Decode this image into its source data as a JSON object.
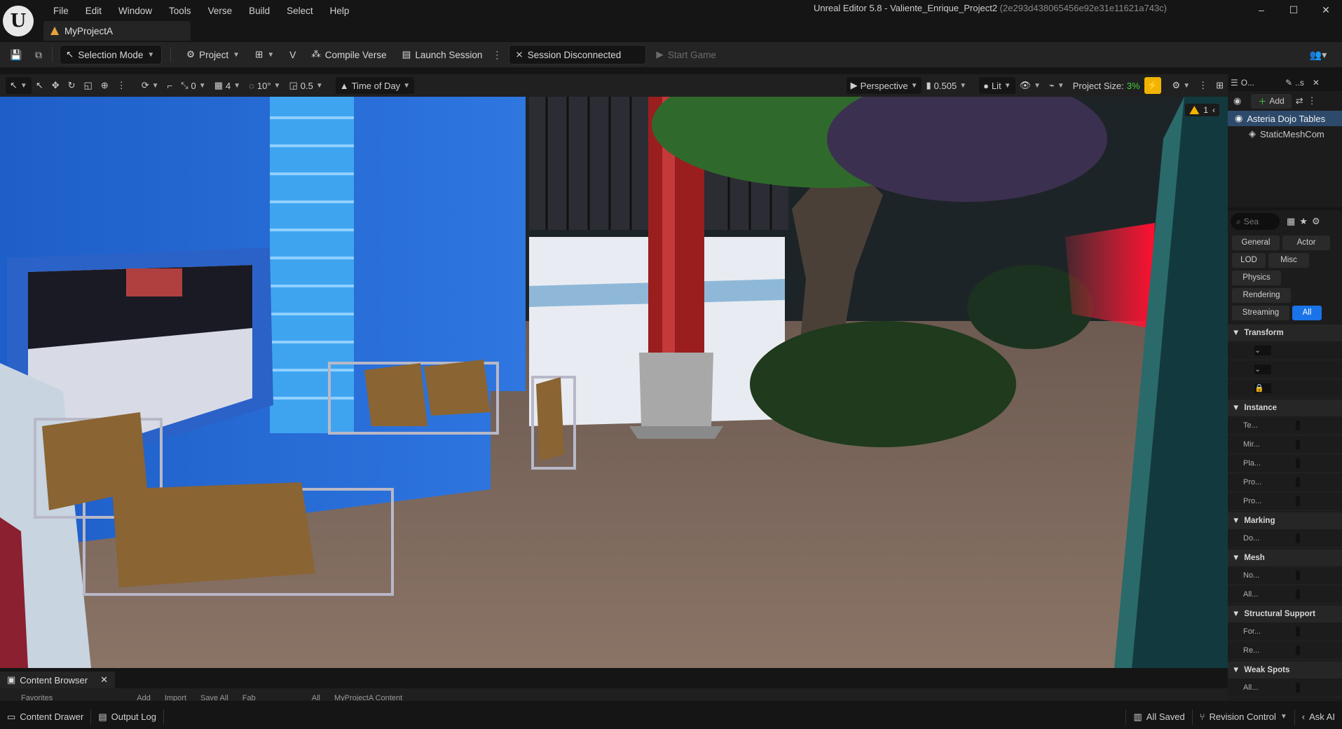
{
  "window": {
    "title": "Unreal Editor 5.8 - Valiente_Enrique_Project2",
    "hash": "(2e293d438065456e92e31e11621a743c)",
    "controls": [
      "–",
      "☐",
      "✕"
    ]
  },
  "menu": [
    "File",
    "Edit",
    "Window",
    "Tools",
    "Verse",
    "Build",
    "Select",
    "Help"
  ],
  "project_tab": "MyProjectA",
  "toolbar": {
    "selection_mode": "Selection Mode",
    "project": "Project",
    "compile_verse": "Compile Verse",
    "launch_session": "Launch Session",
    "session_status": "Session Disconnected",
    "start_game": "Start Game"
  },
  "viewport_toolbar": {
    "rotation_snap_value": "0",
    "grid_snap": "4",
    "angle_snap": "10°",
    "scale_snap": "0.5",
    "time_of_day": "Time of Day",
    "perspective": "Perspective",
    "camera_speed": "0.505",
    "view_mode": "Lit",
    "project_size_label": "Project Size:",
    "project_size_value": "3%",
    "warning_count": "1"
  },
  "outliner": {
    "tab_label": "O...",
    "tab2_label": "..s",
    "add_label": "Add",
    "items": [
      {
        "label": "Asteria Dojo Tables",
        "selected": true
      },
      {
        "label": "StaticMeshCom",
        "selected": false
      }
    ]
  },
  "details": {
    "search_placeholder": "Sea",
    "filters": [
      "General",
      "Actor",
      "LOD",
      "Misc",
      "Physics",
      "Rendering",
      "Streaming",
      "All"
    ],
    "active_filter": "All",
    "sections": [
      {
        "title": "Transform",
        "rows": []
      },
      {
        "title": "Instance",
        "rows": [
          "Te...",
          "Mir...",
          "Pla...",
          "Pro...",
          "Pro..."
        ]
      },
      {
        "title": "Marking",
        "rows": [
          "Do..."
        ]
      },
      {
        "title": "Mesh",
        "rows": [
          "No...",
          "All..."
        ]
      },
      {
        "title": "Structural Support",
        "rows": [
          "For...",
          "Re..."
        ]
      },
      {
        "title": "Weak Spots",
        "rows": [
          "All..."
        ]
      }
    ]
  },
  "content_browser": {
    "tab": "Content Browser",
    "strip": [
      "Favorites",
      "Add",
      "Import",
      "Save All",
      "Fab",
      "All",
      "MyProjectA Content"
    ]
  },
  "statusbar": {
    "content_drawer": "Content Drawer",
    "output_log": "Output Log",
    "all_saved": "All Saved",
    "revision_control": "Revision Control",
    "ask_ai": "Ask AI"
  },
  "colors": {
    "accent": "#1a73e8",
    "selection": "#2e4a6a",
    "project_size_green": "#3fd13f",
    "warning": "#f0b400"
  }
}
